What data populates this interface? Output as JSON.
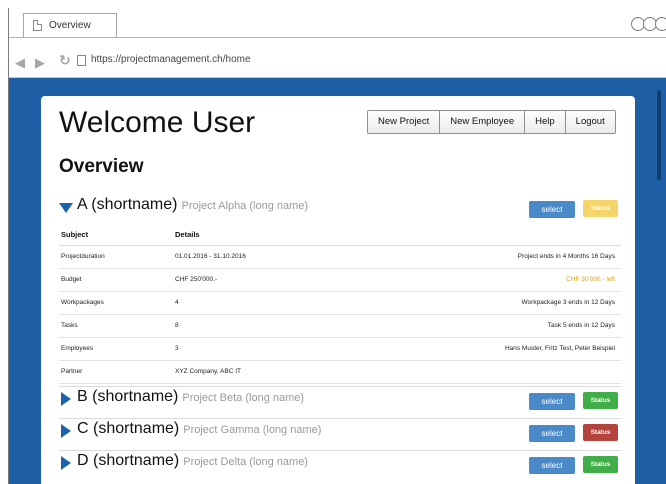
{
  "browser": {
    "tab_title": "Overview",
    "url": "https://projectmanagement.ch/home"
  },
  "page": {
    "welcome": "Welcome User",
    "overview_title": "Overview",
    "nav": [
      "New Project",
      "New Employee",
      "Help",
      "Logout"
    ]
  },
  "details_headers": {
    "subject": "Subject",
    "details": "Details"
  },
  "projects": [
    {
      "shortname": "A (shortname)",
      "longname": "Project Alpha (long name)",
      "select": "select",
      "status": "Status",
      "status_color": "#f5d46a",
      "expanded": true,
      "rows": [
        {
          "subject": "Projectduration",
          "details": "01.01.2016 - 31.10.2016",
          "note": "Project ends in 4 Months 16 Days",
          "warn": false
        },
        {
          "subject": "Budget",
          "details": "CHF 250'000.-",
          "note": "CHF 30'000.- left",
          "warn": true
        },
        {
          "subject": "Workpackages",
          "details": "4",
          "note": "Workpackage 3 ends in 12 Days",
          "warn": false
        },
        {
          "subject": "Tasks",
          "details": "8",
          "note": "Task 5 ends in 12 Days",
          "warn": false
        },
        {
          "subject": "Employees",
          "details": "3",
          "note": "Hans Muster, Fritz Test, Peter Beispiel",
          "warn": false
        },
        {
          "subject": "Partner",
          "details": "XYZ Company, ABC IT",
          "note": "",
          "warn": false
        }
      ]
    },
    {
      "shortname": "B (shortname)",
      "longname": "Project Beta (long name)",
      "select": "select",
      "status": "Status",
      "status_color": "#3fae49",
      "expanded": false
    },
    {
      "shortname": "C (shortname)",
      "longname": "Project Gamma (long name)",
      "select": "select",
      "status": "Status",
      "status_color": "#b5433d",
      "expanded": false
    },
    {
      "shortname": "D (shortname)",
      "longname": "Project Delta (long name)",
      "select": "select",
      "status": "Status",
      "status_color": "#3fae49",
      "expanded": false
    }
  ],
  "colors": {
    "accent": "#1f5fa6",
    "select_button": "#4a8ac8"
  }
}
